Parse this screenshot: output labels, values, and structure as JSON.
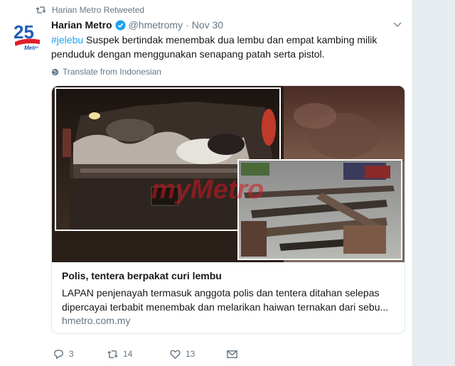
{
  "retweet": {
    "label": "Harian Metro Retweeted"
  },
  "author": {
    "name": "Harian Metro",
    "handle": "@hmetromy",
    "separator": "·",
    "date": "Nov 30"
  },
  "avatar": {
    "number": "25",
    "brand": "Metro"
  },
  "tweet": {
    "hashtag": "#jelebu",
    "text": " Suspek bertindak menembak dua lembu dan empat kambing milik penduduk dengan menggunakan senapang patah serta pistol."
  },
  "translate": {
    "label": "Translate from Indonesian"
  },
  "card": {
    "watermark": "myMetro",
    "title": "Polis, tentera berpakat curi lembu",
    "description": "LAPAN penjenayah termasuk anggota polis dan tentera ditahan selepas dipercayai terbabit menembak dan melarikan haiwan ternakan dari sebu...",
    "url": "hmetro.com.my"
  },
  "actions": {
    "reply_count": "3",
    "retweet_count": "14",
    "like_count": "13"
  },
  "colors": {
    "accent": "#1da1f2",
    "secondary_text": "#657786",
    "brand_red": "#e0202b",
    "brand_blue": "#1e5db8"
  }
}
